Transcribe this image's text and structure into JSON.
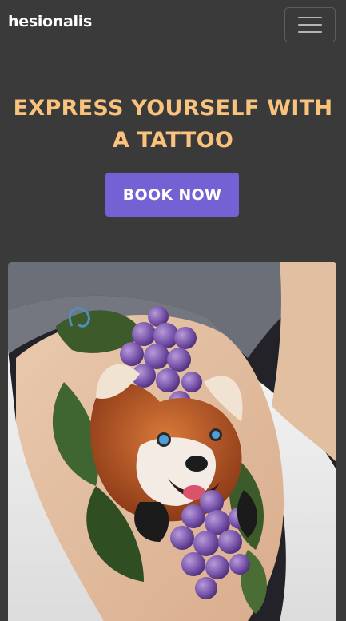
{
  "brand": {
    "name": "hesionalis"
  },
  "navbar": {
    "toggler_icon": "hamburger-menu-icon"
  },
  "hero": {
    "title": "EXPRESS YOURSELF WITH A TATTOO",
    "cta_label": "BOOK NOW"
  },
  "colors": {
    "background": "#3a3a3a",
    "title": "#f9c27d",
    "cta": "#7462d4",
    "brand": "#ffffff"
  },
  "gallery": {
    "image_subject": "red-panda-grapes-tattoo-photo"
  }
}
